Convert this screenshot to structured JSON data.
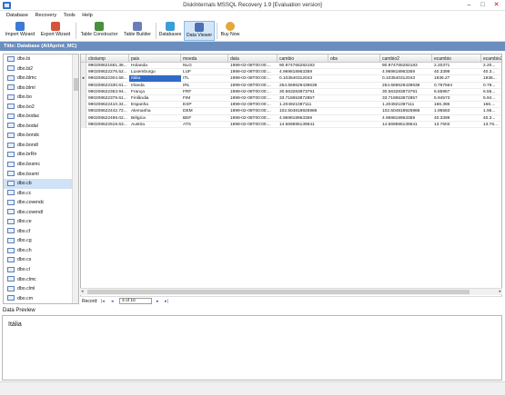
{
  "window": {
    "title": "DiskInternals MSSQL Recovery 1.9 [Evaluation version]"
  },
  "menu": [
    "Database",
    "Recovery",
    "Tools",
    "Help"
  ],
  "toolbar": [
    {
      "label": "Import Wizard",
      "icon": "import-wizard-icon",
      "color": "#3b7bd4"
    },
    {
      "label": "Export Wizard",
      "icon": "export-wizard-icon",
      "color": "#d4553b"
    },
    {
      "label": "Table Constructor",
      "icon": "table-constructor-icon",
      "color": "#4a8f3c"
    },
    {
      "label": "Table Builder",
      "icon": "table-builder-icon",
      "color": "#6a7fb8"
    },
    {
      "label": "Databases",
      "icon": "databases-icon",
      "color": "#3a9fd6"
    },
    {
      "label": "Data Viewer",
      "icon": "data-viewer-icon",
      "color": "#4d6fb3"
    },
    {
      "label": "Buy Now",
      "icon": "buy-now-icon",
      "color": "#e2a83a"
    }
  ],
  "db_title": "Title: Database (AllAprint_MC)",
  "sidebar": {
    "items": [
      "dbo.bi",
      "dbo.bi2",
      "dbo.blmc",
      "dbo.blml",
      "dbo.bo",
      "dbo.bo2",
      "dbo.bodac",
      "dbo.bodal",
      "dbo.bondc",
      "dbo.bondl",
      "dbo.brRn",
      "dbo.bxsmc",
      "dbo.bxsml",
      "dbo.cb",
      "dbo.cc",
      "dbo.covendc",
      "dbo.covendl",
      "dbo.ce",
      "dbo.cf",
      "dbo.cg",
      "dbo.ch",
      "dbo.cs",
      "dbo.cl",
      "dbo.clmc",
      "dbo.clml",
      "dbo.cm",
      "dbo.cn.i",
      "dbo.cn2",
      "dbo.cn3"
    ],
    "selected_index": 13
  },
  "grid": {
    "columns": [
      "cbstamp",
      "pais",
      "moeda",
      "data",
      "cambio",
      "obs",
      "cambio2",
      "ecambio",
      "ecambio2"
    ],
    "rows": [
      [
        "990208621651.36...",
        "Holanda",
        "NLG",
        "1999-02-08T00:00:...",
        "90.974765282183",
        "",
        "90.974765282183",
        "2.20371",
        "2.20..."
      ],
      [
        "990208622276.52...",
        "Luxemburgo",
        "LUF",
        "1999-02-08T00:00:...",
        "4.969818963359",
        "",
        "4.969818963359",
        "40.3399",
        "40.3..."
      ],
      [
        "990208622304.58...",
        "Itália",
        "ITL",
        "1999-02-08T00:00:...",
        "0.103540312043",
        "",
        "0.103540312043",
        "1936.27",
        "1936..."
      ],
      [
        "990208622330.61...",
        "Irlanda",
        "IRL",
        "1999-02-08T00:00:...",
        "254.559629439639",
        "",
        "254.559629439639",
        "0.787564",
        "0.78..."
      ],
      [
        "990208622353.94...",
        "França",
        "FRF",
        "1999-02-08T00:00:...",
        "30.563283873791",
        "",
        "30.563283873791",
        "6.55957",
        "6.55..."
      ],
      [
        "990208622379.61...",
        "Finlândia",
        "FIM",
        "1999-02-08T00:00:...",
        "33.718653872857",
        "",
        "33.718653872857",
        "5.94573",
        "5.94..."
      ],
      [
        "990208622410.34...",
        "Espanha",
        "ESP",
        "1999-02-08T00:00:...",
        "1.204921087111",
        "",
        "1.204921087111",
        "166.386",
        "166...."
      ],
      [
        "990208622442.72...",
        "Alemanha",
        "DEM",
        "1999-02-08T00:00:...",
        "102.504818925986",
        "",
        "102.504818925986",
        "1.95583",
        "1.95..."
      ],
      [
        "990208622499.02...",
        "Bélgica",
        "BEF",
        "1999-02-08T00:00:...",
        "4.969818963359",
        "",
        "4.969818963359",
        "40.3399",
        "40.3..."
      ],
      [
        "990208622519.63...",
        "Austria",
        "ATS",
        "1999-02-08T00:00:...",
        "14.569595139641",
        "",
        "14.569595139641",
        "13.7603",
        "13.76..."
      ]
    ],
    "selected_row": 2,
    "selected_col": 1
  },
  "nav": {
    "label": "Record:",
    "page": "3 of 10"
  },
  "preview": {
    "label": "Data Preview",
    "text": "Itália"
  }
}
